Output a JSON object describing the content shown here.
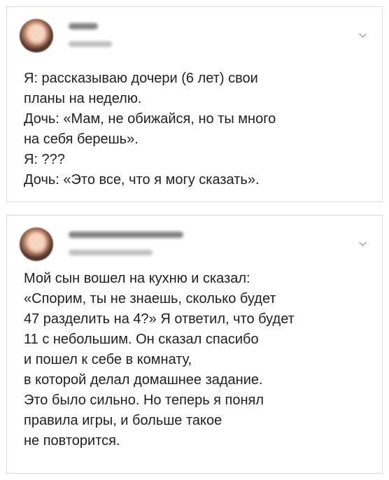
{
  "posts": [
    {
      "avatar_alt": "avatar",
      "chevron_icon": "chevron-down-icon",
      "text": "Я: рассказываю дочери (6 лет) свои\nпланы на неделю.\nДочь: «Мам, не обижайся, но ты много\nна себя берешь».\nЯ: ???\nДочь: «Это все, что я могу сказать»."
    },
    {
      "avatar_alt": "avatar",
      "chevron_icon": "chevron-down-icon",
      "text": "Мой сын вошел на кухню и сказал:\n«Спорим, ты не знаешь, сколько будет\n47 разделить на 4?» Я ответил, что будет\n11 с небольшим. Он сказал спасибо\nи пошел к себе в комнату,\nв которой делал домашнее задание.\nЭто было сильно. Но теперь я понял\nправила игры, и больше такое\nне повторится."
    }
  ],
  "colors": {
    "background": "#ffffff",
    "card_border": "#dcdcdc",
    "text": "#202020",
    "chevron": "#9a9a9a"
  }
}
